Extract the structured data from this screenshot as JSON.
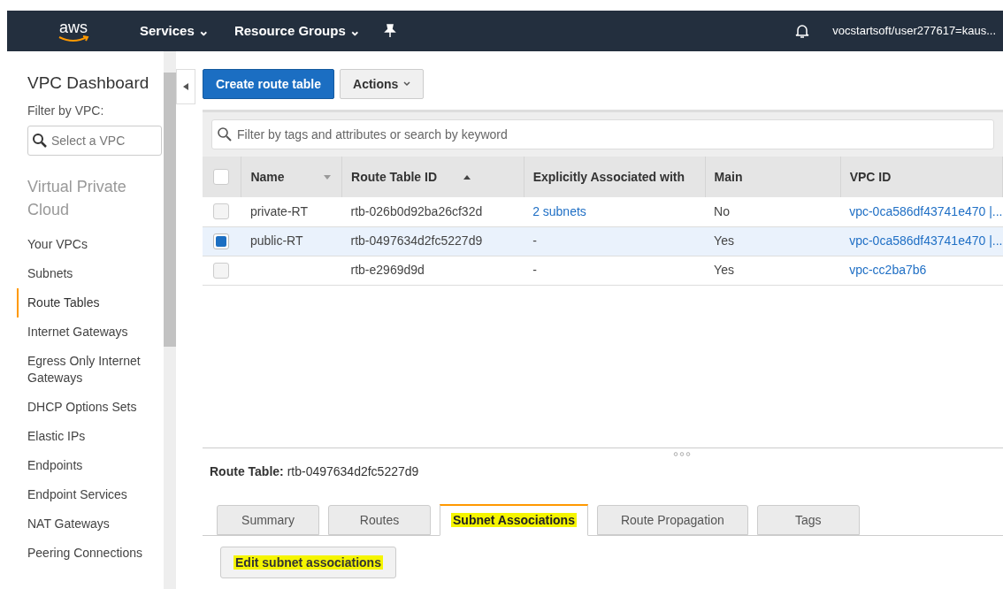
{
  "top_nav": {
    "logo": "aws",
    "menus": [
      {
        "label": "Services",
        "caret": "⌄"
      },
      {
        "label": "Resource Groups",
        "caret": "⌄"
      }
    ],
    "account": "vocstartsoft/user277617=kaus..."
  },
  "sidebar": {
    "title": "VPC Dashboard",
    "filter_label": "Filter by VPC:",
    "filter_placeholder": "Select a VPC",
    "section": "Virtual Private Cloud",
    "items": [
      {
        "label": "Your VPCs",
        "selected": false
      },
      {
        "label": "Subnets",
        "selected": false
      },
      {
        "label": "Route Tables",
        "selected": true
      },
      {
        "label": "Internet Gateways",
        "selected": false
      },
      {
        "label": "Egress Only Internet Gateways",
        "selected": false
      },
      {
        "label": "DHCP Options Sets",
        "selected": false
      },
      {
        "label": "Elastic IPs",
        "selected": false
      },
      {
        "label": "Endpoints",
        "selected": false
      },
      {
        "label": "Endpoint Services",
        "selected": false
      },
      {
        "label": "NAT Gateways",
        "selected": false
      },
      {
        "label": "Peering Connections",
        "selected": false
      }
    ]
  },
  "toolbar": {
    "create_button": "Create route table",
    "actions_button": "Actions"
  },
  "search": {
    "placeholder": "Filter by tags and attributes or search by keyword"
  },
  "table": {
    "all_selected": false,
    "columns": [
      "Name",
      "Route Table ID",
      "Explicitly Associated with",
      "Main",
      "VPC ID"
    ],
    "rows": [
      {
        "selected": false,
        "name": "private-RT",
        "id": "rtb-026b0d92ba26cf32d",
        "associated": "2 subnets",
        "associated_link": true,
        "main": "No",
        "vpc": "vpc-0ca586df43741e470 |..."
      },
      {
        "selected": true,
        "name": "public-RT",
        "id": "rtb-0497634d2fc5227d9",
        "associated": "-",
        "associated_link": false,
        "main": "Yes",
        "vpc": "vpc-0ca586df43741e470 |..."
      },
      {
        "selected": false,
        "name": "",
        "id": "rtb-e2969d9d",
        "associated": "-",
        "associated_link": false,
        "main": "Yes",
        "vpc": "vpc-cc2ba7b6"
      }
    ]
  },
  "details": {
    "label": "Route Table:",
    "value": "rtb-0497634d2fc5227d9",
    "tabs": [
      {
        "label": "Summary",
        "selected": false,
        "highlighted": false
      },
      {
        "label": "Routes",
        "selected": false,
        "highlighted": false
      },
      {
        "label": "Subnet Associations",
        "selected": true,
        "highlighted": true
      },
      {
        "label": "Route Propagation",
        "selected": false,
        "highlighted": false
      },
      {
        "label": "Tags",
        "selected": false,
        "highlighted": false
      }
    ],
    "action_button": {
      "label": "Edit subnet associations",
      "highlighted": true
    }
  }
}
